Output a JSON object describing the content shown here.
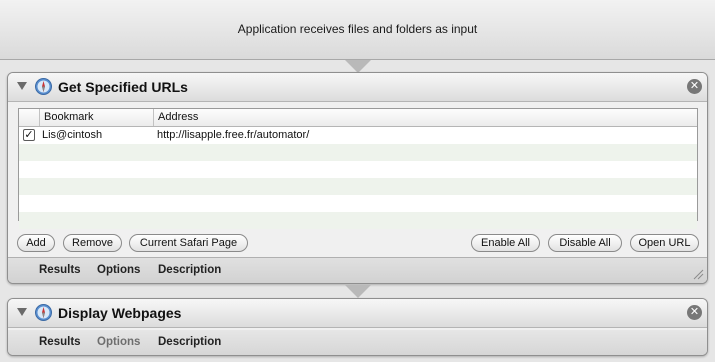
{
  "header": {
    "text": "Application receives files and folders as input"
  },
  "actions": [
    {
      "name": "Get Specified URLs",
      "icon": "safari-icon",
      "table": {
        "columns": [
          "Bookmark",
          "Address"
        ],
        "rows": [
          {
            "checked": true,
            "bookmark": "Lis@cintosh",
            "address": "http://lisapple.free.fr/automator/"
          }
        ]
      },
      "buttons": {
        "add": "Add",
        "remove": "Remove",
        "current_safari_page": "Current Safari Page",
        "enable_all": "Enable All",
        "disable_all": "Disable All",
        "open_url": "Open URL"
      },
      "tabs": [
        "Results",
        "Options",
        "Description"
      ]
    },
    {
      "name": "Display Webpages",
      "icon": "safari-icon",
      "tabs": [
        "Results",
        "Options",
        "Description"
      ],
      "disabled_tab": "Options"
    }
  ],
  "colors": {
    "row_alt": "#eef3ec",
    "action_bg": "#f0f0f0",
    "tab_dim": "#6e6e6e"
  }
}
